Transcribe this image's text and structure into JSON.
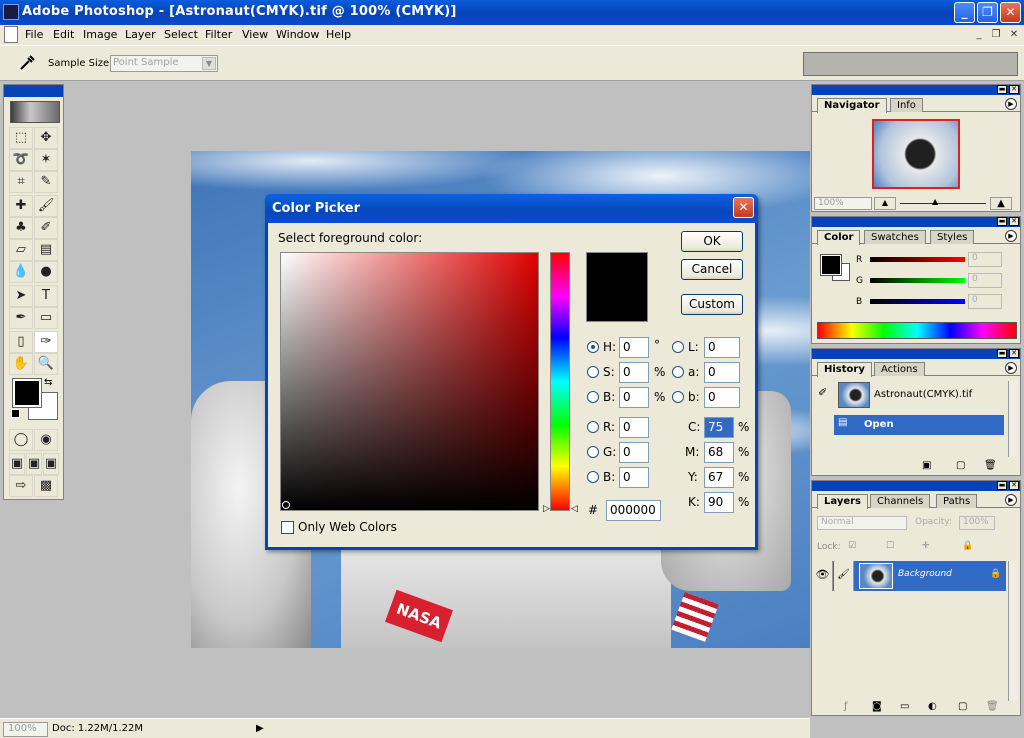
{
  "window": {
    "title": "Adobe Photoshop - [Astronaut(CMYK).tif @ 100% (CMYK)]"
  },
  "menu": [
    "File",
    "Edit",
    "Image",
    "Layer",
    "Select",
    "Filter",
    "View",
    "Window",
    "Help"
  ],
  "options_bar": {
    "sample_size_label": "Sample Size:",
    "sample_size_value": "Point Sample"
  },
  "status": {
    "zoom": "100%",
    "doc": "Doc: 1.22M/1.22M"
  },
  "color_picker": {
    "title": "Color Picker",
    "prompt": "Select foreground color:",
    "buttons": {
      "ok": "OK",
      "cancel": "Cancel",
      "custom": "Custom"
    },
    "hsb": {
      "h_label": "H:",
      "h": "0",
      "h_unit": "°",
      "s_label": "S:",
      "s": "0",
      "s_unit": "%",
      "b_label": "B:",
      "b": "0",
      "b_unit": "%"
    },
    "rgb": {
      "r_label": "R:",
      "r": "0",
      "g_label": "G:",
      "g": "0",
      "b_label": "B:",
      "b": "0"
    },
    "lab": {
      "l_label": "L:",
      "l": "0",
      "a_label": "a:",
      "a": "0",
      "b_label": "b:",
      "b": "0"
    },
    "cmyk": {
      "c_label": "C:",
      "c": "75",
      "m_label": "M:",
      "m": "68",
      "y_label": "Y:",
      "y": "67",
      "k_label": "K:",
      "k": "90",
      "unit": "%"
    },
    "hex_label": "#",
    "hex": "000000",
    "web_colors_label": "Only Web Colors"
  },
  "navigator": {
    "tabs": [
      "Navigator",
      "Info"
    ],
    "zoom": "100%"
  },
  "color_palette": {
    "tabs": [
      "Color",
      "Swatches",
      "Styles"
    ],
    "r_label": "R",
    "g_label": "G",
    "b_label": "B",
    "r": "0",
    "g": "0",
    "b": "0"
  },
  "history": {
    "tabs": [
      "History",
      "Actions"
    ],
    "snapshot": "Astronaut(CMYK).tif",
    "step": "Open"
  },
  "layers": {
    "tabs": [
      "Layers",
      "Channels",
      "Paths"
    ],
    "blend_mode": "Normal",
    "opacity_label": "Opacity:",
    "opacity": "100%",
    "lock_label": "Lock:",
    "layer_name": "Background"
  },
  "colors": {
    "title_blue": "#0842b7",
    "selection_blue": "#316ac5",
    "foreground": "#000000"
  }
}
